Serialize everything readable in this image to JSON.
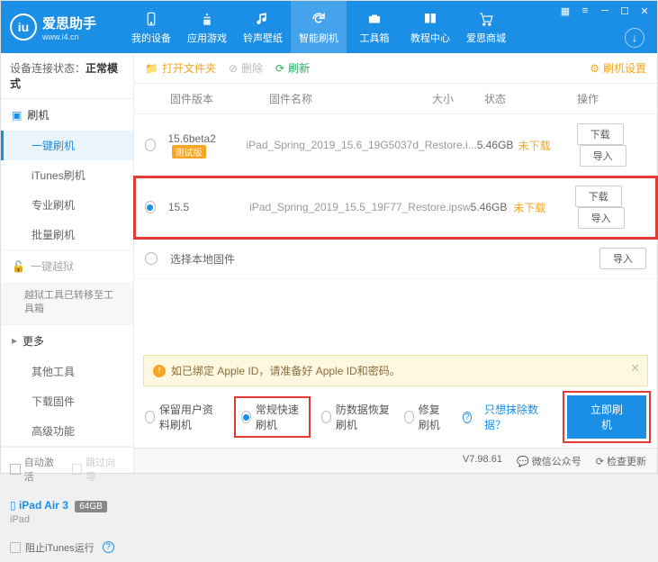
{
  "app": {
    "name": "爱思助手",
    "url": "www.i4.cn"
  },
  "nav": {
    "items": [
      {
        "label": "我的设备"
      },
      {
        "label": "应用游戏"
      },
      {
        "label": "铃声壁纸"
      },
      {
        "label": "智能刷机"
      },
      {
        "label": "工具箱"
      },
      {
        "label": "教程中心"
      },
      {
        "label": "爱思商城"
      }
    ],
    "activeIndex": 3
  },
  "connection": {
    "label": "设备连接状态：",
    "value": "正常模式"
  },
  "sidebar": {
    "flash": {
      "head": "刷机",
      "items": [
        "一键刷机",
        "iTunes刷机",
        "专业刷机",
        "批量刷机"
      ],
      "activeIndex": 0
    },
    "jailbreak": {
      "head": "一键越狱",
      "note": "越狱工具已转移至工具箱"
    },
    "more": {
      "head": "更多",
      "items": [
        "其他工具",
        "下载固件",
        "高级功能"
      ]
    },
    "opts": {
      "autoActivate": "自动激活",
      "skipGuide": "跳过向导"
    },
    "device": {
      "name": "iPad Air 3",
      "storage": "64GB",
      "model": "iPad"
    },
    "foot": {
      "blockItunes": "阻止iTunes运行"
    }
  },
  "toolbar": {
    "openFolder": "打开文件夹",
    "delete": "删除",
    "refresh": "刷新",
    "settings": "刷机设置"
  },
  "table": {
    "headers": {
      "version": "固件版本",
      "name": "固件名称",
      "size": "大小",
      "state": "状态",
      "ops": "操作"
    },
    "rows": [
      {
        "version": "15.6beta2",
        "tag": "测试版",
        "name": "iPad_Spring_2019_15.6_19G5037d_Restore.i...",
        "size": "5.46GB",
        "state": "未下载",
        "selected": false
      },
      {
        "version": "15.5",
        "tag": "",
        "name": "iPad_Spring_2019_15.5_19F77_Restore.ipsw",
        "size": "5.46GB",
        "state": "未下载",
        "selected": true
      }
    ],
    "localRow": "选择本地固件",
    "btnDownload": "下载",
    "btnImport": "导入"
  },
  "notice": {
    "text": "如已绑定 Apple ID，请准备好 Apple ID和密码。"
  },
  "actions": {
    "opts": [
      "保留用户资料刷机",
      "常规快速刷机",
      "防数据恢复刷机",
      "修复刷机"
    ],
    "selectedIndex": 1,
    "excludeLink": "只想抹除数据？",
    "flashNow": "立即刷机"
  },
  "status": {
    "version": "V7.98.61",
    "wechat": "微信公众号",
    "checkUpdate": "检查更新"
  }
}
